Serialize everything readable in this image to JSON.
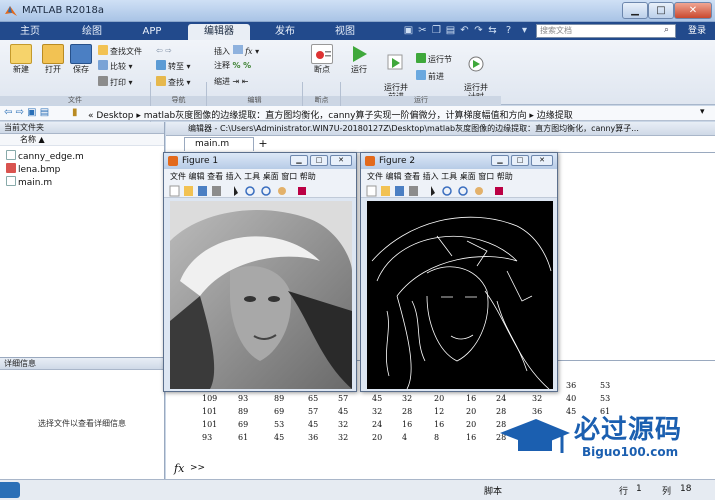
{
  "window": {
    "title": "MATLAB R2018a"
  },
  "tabs": [
    "主页",
    "绘图",
    "APP",
    "编辑器",
    "发布",
    "视图"
  ],
  "active_tab": 3,
  "search": {
    "placeholder": "搜索文档"
  },
  "login": "登录",
  "ribbon": {
    "file": {
      "new": "新建",
      "open": "打开",
      "save": "保存",
      "find_files": "查找文件",
      "compare": "比较",
      "print": "打印",
      "group": "文件"
    },
    "navigate": {
      "goto": "转至",
      "find": "查找",
      "group": "导航"
    },
    "edit": {
      "insert": "插入",
      "comment": "注释",
      "indent": "缩进",
      "group": "编辑"
    },
    "breakpoints": {
      "label": "断点",
      "group": "断点"
    },
    "run": {
      "run": "运行",
      "run_advance": "运行并\n前进",
      "run_section": "运行节",
      "advance": "前进",
      "run_time": "运行并\n计时",
      "group": "运行"
    }
  },
  "address": {
    "path": "« Desktop ▸ matlab灰度图像的边缘提取：直方图均衡化，canny算子实现一阶偏微分，计算梯度幅值和方向 ▸ 边缘提取"
  },
  "current_folder": {
    "title": "当前文件夹",
    "column": "名称 ▲",
    "files": [
      "canny_edge.m",
      "lena.bmp",
      "main.m"
    ]
  },
  "details": {
    "title": "详细信息",
    "hint": "选择文件以查看详细信息"
  },
  "editor": {
    "title": "编辑器 - C:\\Users\\Administrator.WIN7U-20180127Z\\Desktop\\matlab灰度图像的边缘提取：直方图均衡化，canny算子...",
    "tab": "main.m"
  },
  "figures": [
    {
      "title": "Figure 1",
      "menu": "文件 编辑 查看 插入 工具 桌面 窗口 帮助"
    },
    {
      "title": "Figure 2",
      "menu": "文件 编辑 查看 插入 工具 桌面 窗口 帮助"
    }
  ],
  "command_window": {
    "rows": [
      [
        "",
        "",
        "",
        "",
        "",
        "",
        "",
        "",
        "",
        "",
        "28",
        "36",
        "53"
      ],
      [
        "109",
        "93",
        "89",
        "65",
        "57",
        "45",
        "32",
        "20",
        "16",
        "24",
        "32",
        "40",
        "53"
      ],
      [
        "101",
        "89",
        "69",
        "57",
        "45",
        "32",
        "28",
        "12",
        "20",
        "28",
        "36",
        "45",
        "61"
      ],
      [
        "101",
        "69",
        "53",
        "45",
        "32",
        "24",
        "16",
        "16",
        "20",
        "28",
        "",
        "",
        ""
      ],
      [
        "93",
        "61",
        "45",
        "36",
        "32",
        "20",
        "4",
        "8",
        "16",
        "28",
        "",
        "",
        ""
      ]
    ],
    "prompt": ">>"
  },
  "status": {
    "script": "脚本",
    "row_label": "行",
    "row": "1",
    "col_label": "列",
    "col": "18"
  },
  "watermark": {
    "text": "必过源码",
    "url": "Biguo100.com"
  }
}
